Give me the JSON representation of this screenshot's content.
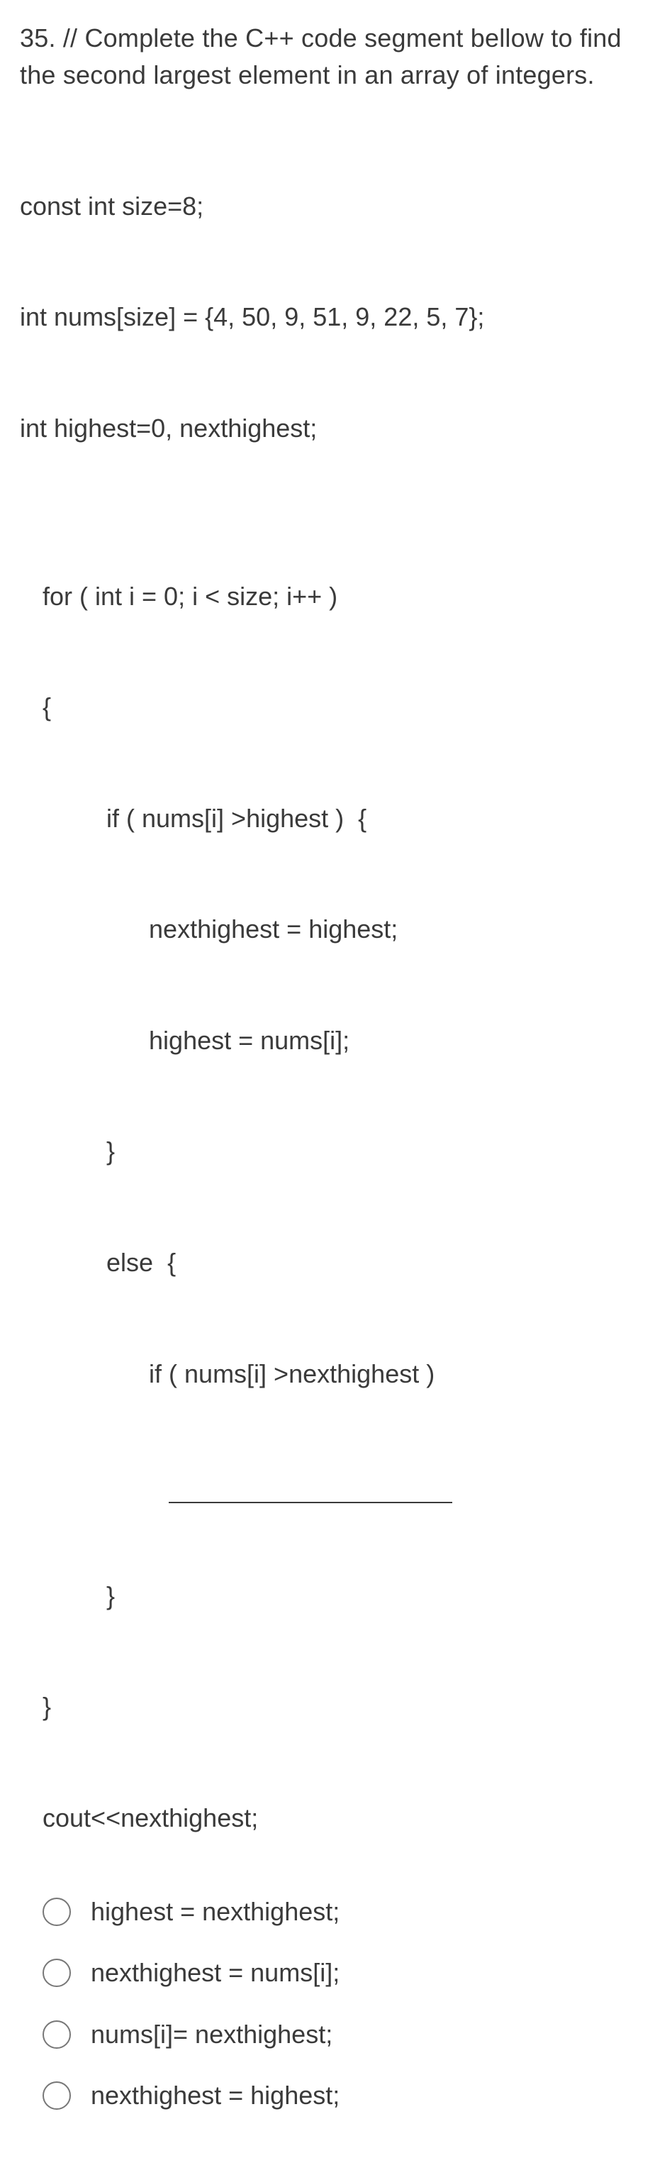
{
  "question": {
    "number": "35.",
    "prompt": "//  Complete the C++ code segment bellow to find the second largest element in an array of integers."
  },
  "code": {
    "declarations": [
      "const int size=8;",
      "int nums[size] = {4, 50, 9, 51, 9, 22, 5, 7};",
      "int highest=0, nexthighest;"
    ],
    "body": [
      "for ( int i = 0; i < size; i++ )",
      "{",
      "         if ( nums[i] >highest )  {",
      "               nexthighest = highest;",
      "               highest = nums[i];",
      "         }",
      "         else  {",
      "               if ( nums[i] >nexthighest )",
      "",
      "         }",
      "}",
      "cout<<nexthighest;"
    ]
  },
  "options": [
    {
      "label": "highest = nexthighest;"
    },
    {
      "label": "nexthighest = nums[i];"
    },
    {
      "label": "nums[i]= nexthighest;"
    },
    {
      "label": "nexthighest = highest;"
    }
  ]
}
